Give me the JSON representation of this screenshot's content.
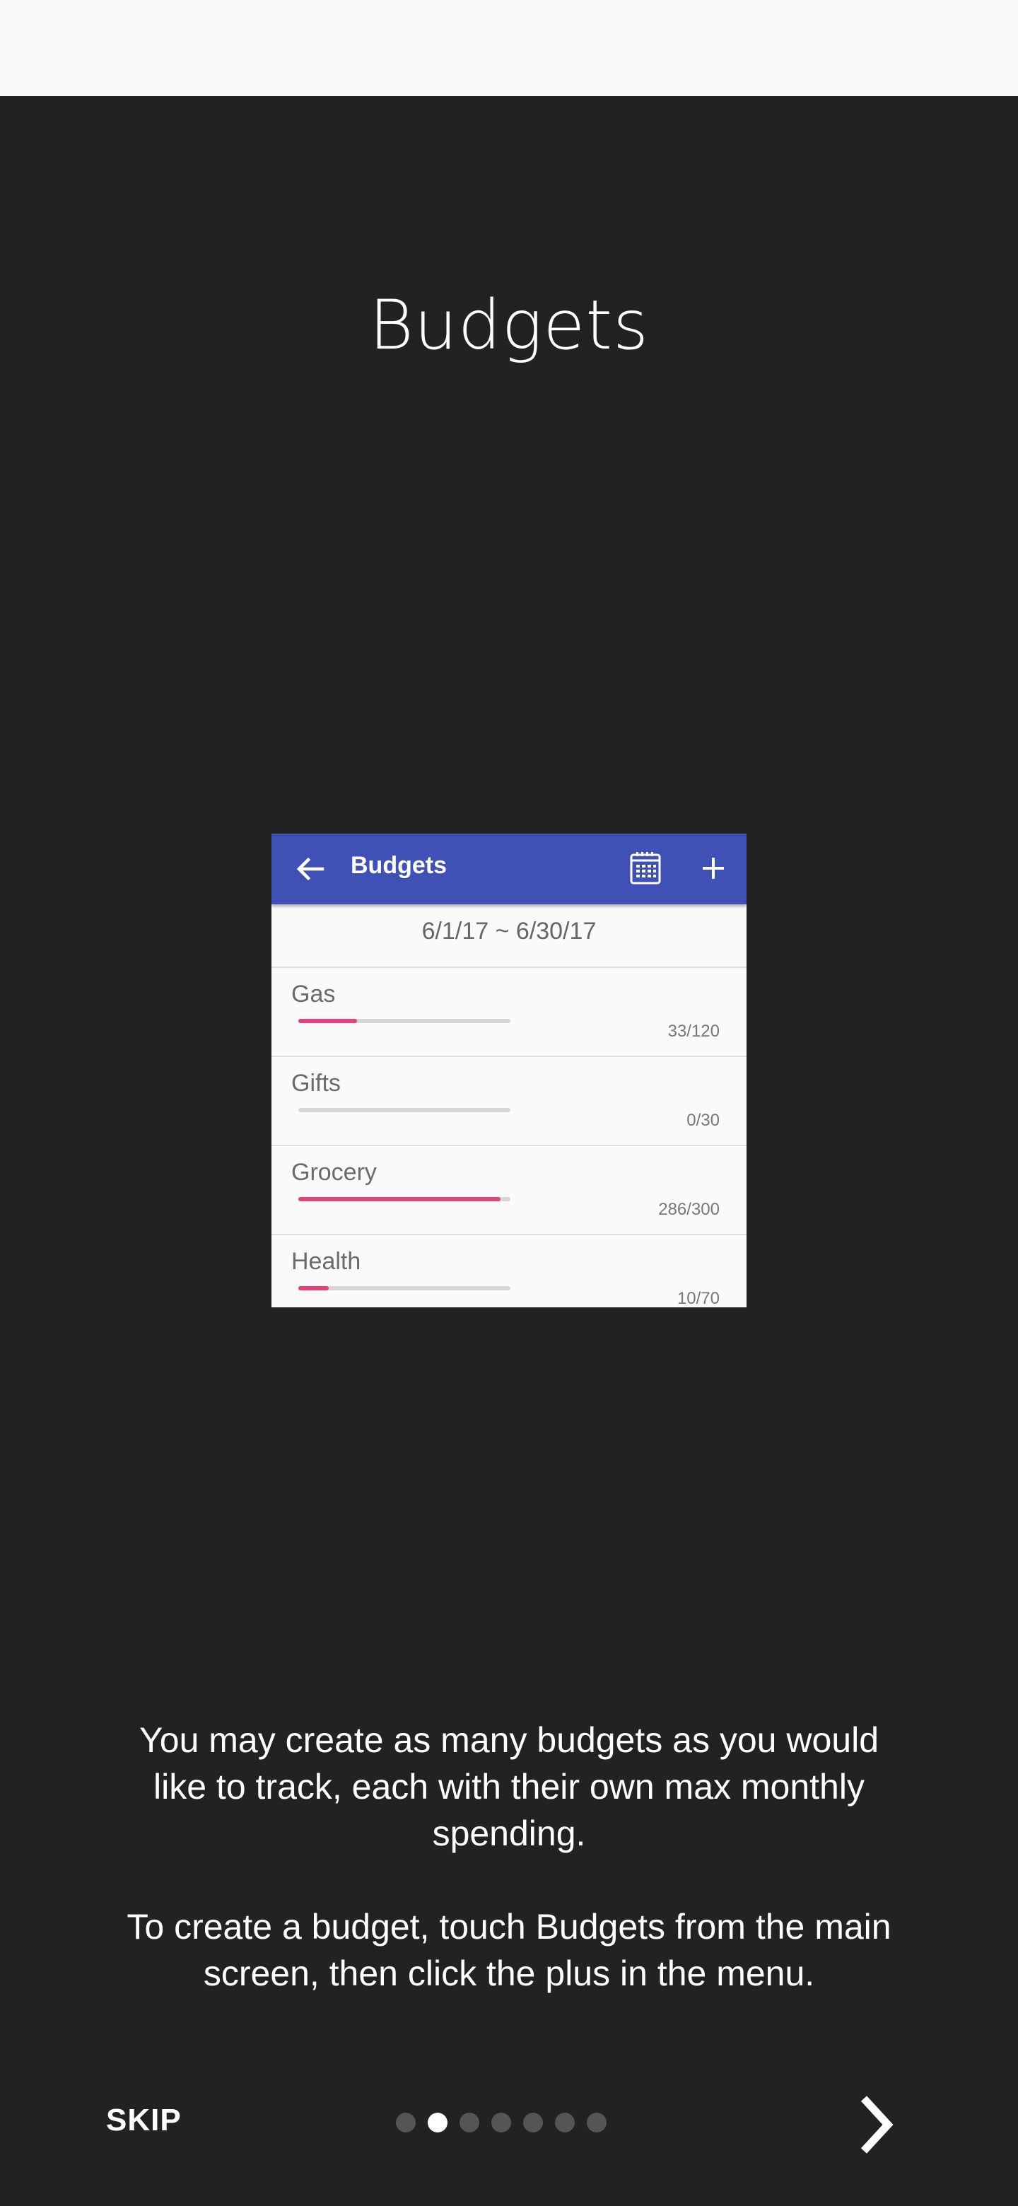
{
  "screen": {
    "title": "Budgets"
  },
  "preview": {
    "appbar_title": "Budgets",
    "date_range": "6/1/17 ~ 6/30/17",
    "accent_color": "#3f51b5",
    "bar_color": "#e9407a",
    "budgets": [
      {
        "name": "Gas",
        "amount": "33/120",
        "spent": 33,
        "max": 120
      },
      {
        "name": "Gifts",
        "amount": "0/30",
        "spent": 0,
        "max": 30
      },
      {
        "name": "Grocery",
        "amount": "286/300",
        "spent": 286,
        "max": 300
      },
      {
        "name": "Health",
        "amount": "10/70",
        "spent": 10,
        "max": 70
      }
    ]
  },
  "description": {
    "paragraph1": "You may create as many budgets as you would like to track, each with their own max monthly spending.",
    "paragraph2": "To create a budget, touch Budgets from the main screen, then click the plus in the menu."
  },
  "footer": {
    "skip_label": "SKIP",
    "page_count": 7,
    "current_page": 2,
    "next_icon": "chevron-right-icon"
  }
}
